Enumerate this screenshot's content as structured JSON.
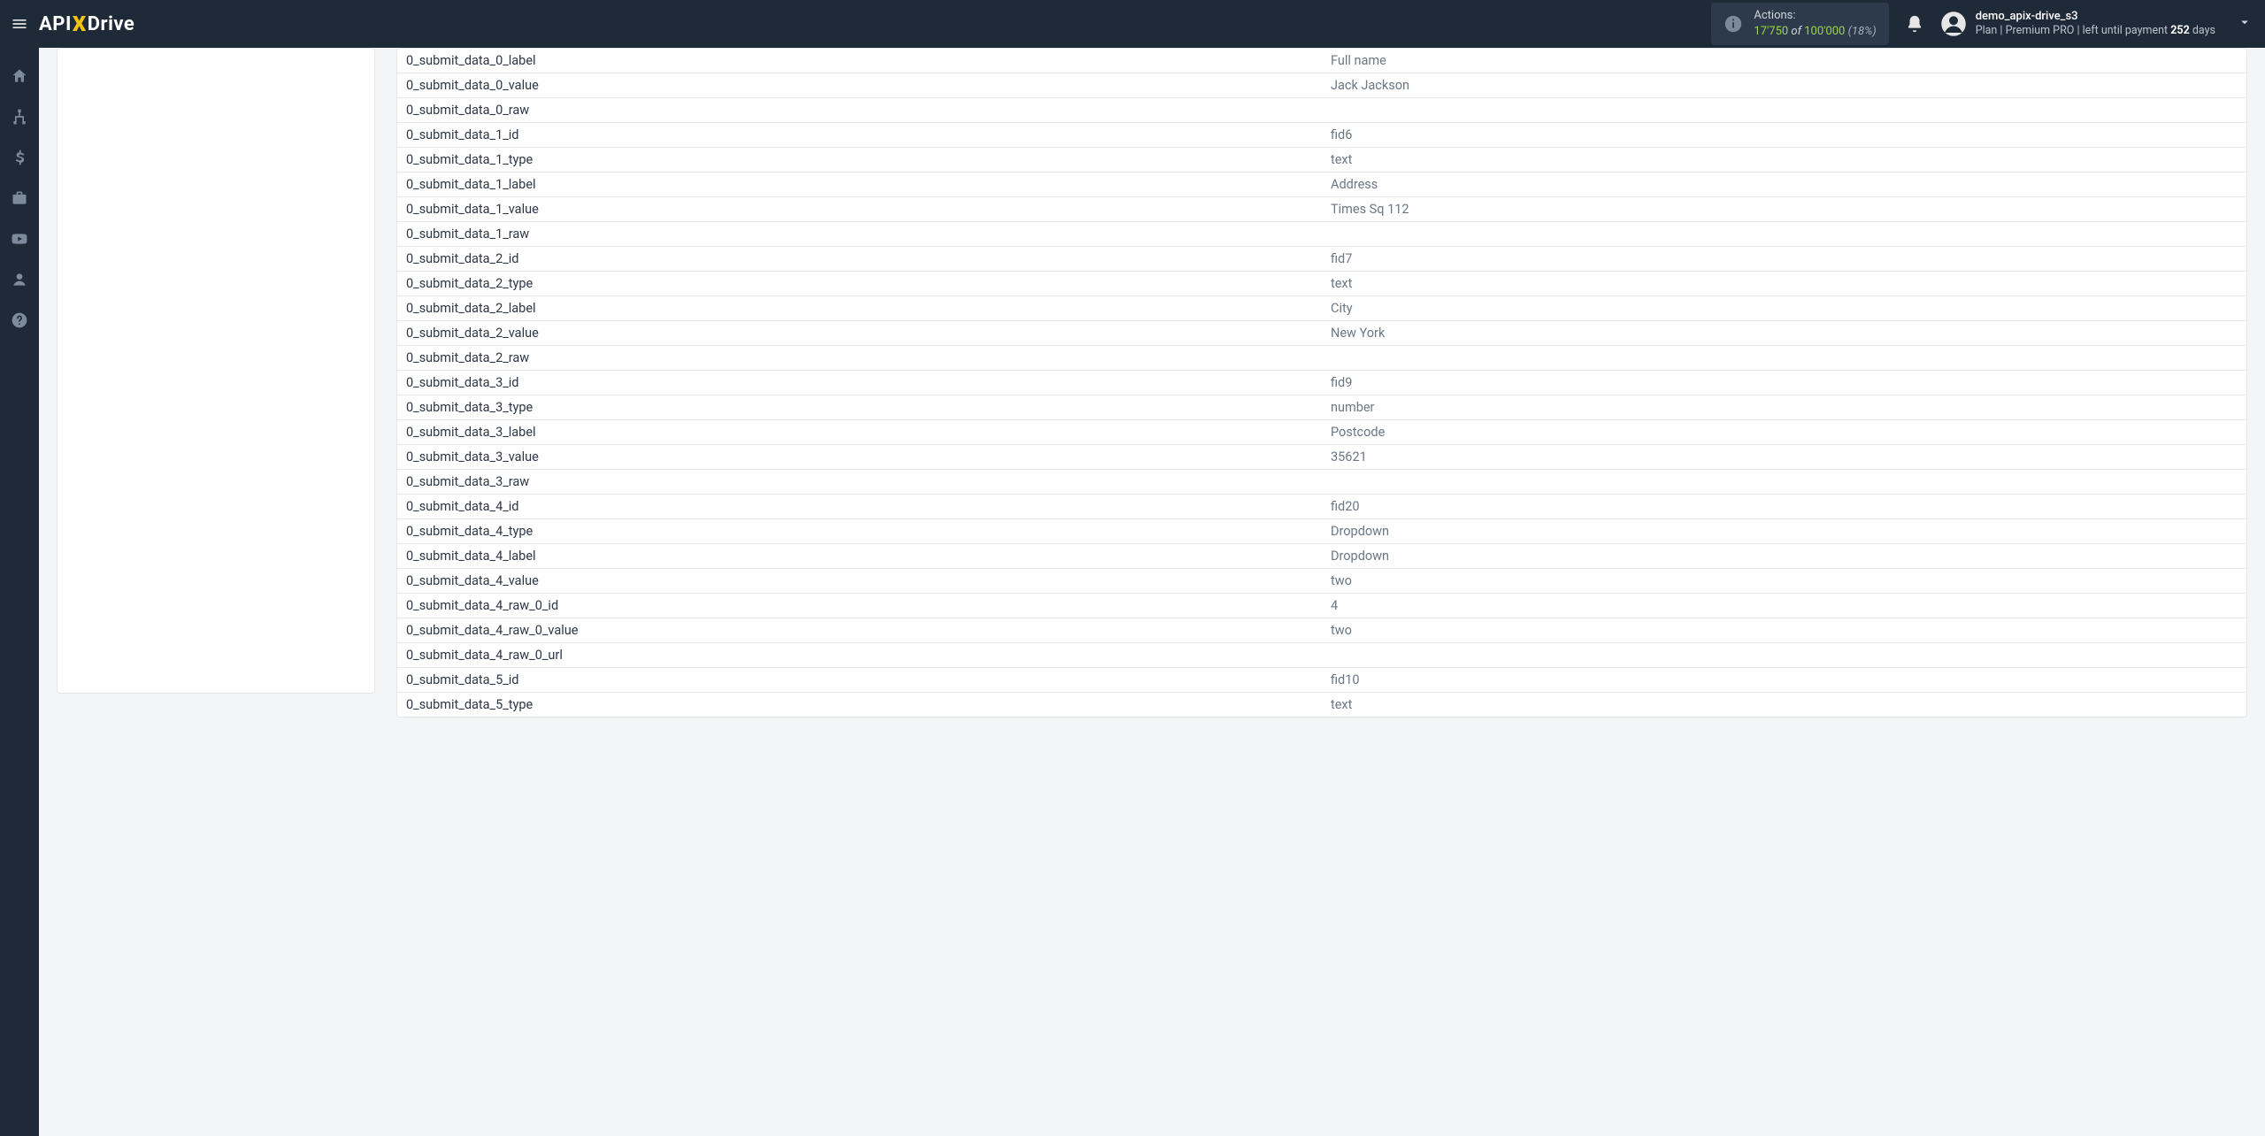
{
  "brand": {
    "api": "API",
    "x": "X",
    "drive": "Drive"
  },
  "header": {
    "actions_label": "Actions:",
    "actions_used": "17'750",
    "actions_of": "of",
    "actions_total": "100'000",
    "actions_pct": "(18%)",
    "username": "demo_apix-drive_s3",
    "plan_prefix": "Plan |",
    "plan_name": "Premium PRO",
    "plan_sep": "| left until payment",
    "days_num": "252",
    "days_label": "days"
  },
  "table_rows": [
    {
      "key": "0_submit_data_0_label",
      "val": "Full name"
    },
    {
      "key": "0_submit_data_0_value",
      "val": "Jack Jackson"
    },
    {
      "key": "0_submit_data_0_raw",
      "val": ""
    },
    {
      "key": "0_submit_data_1_id",
      "val": "fid6"
    },
    {
      "key": "0_submit_data_1_type",
      "val": "text"
    },
    {
      "key": "0_submit_data_1_label",
      "val": "Address"
    },
    {
      "key": "0_submit_data_1_value",
      "val": "Times Sq 112"
    },
    {
      "key": "0_submit_data_1_raw",
      "val": ""
    },
    {
      "key": "0_submit_data_2_id",
      "val": "fid7"
    },
    {
      "key": "0_submit_data_2_type",
      "val": "text"
    },
    {
      "key": "0_submit_data_2_label",
      "val": "City"
    },
    {
      "key": "0_submit_data_2_value",
      "val": "New York"
    },
    {
      "key": "0_submit_data_2_raw",
      "val": ""
    },
    {
      "key": "0_submit_data_3_id",
      "val": "fid9"
    },
    {
      "key": "0_submit_data_3_type",
      "val": "number"
    },
    {
      "key": "0_submit_data_3_label",
      "val": "Postcode"
    },
    {
      "key": "0_submit_data_3_value",
      "val": "35621"
    },
    {
      "key": "0_submit_data_3_raw",
      "val": ""
    },
    {
      "key": "0_submit_data_4_id",
      "val": "fid20"
    },
    {
      "key": "0_submit_data_4_type",
      "val": "Dropdown"
    },
    {
      "key": "0_submit_data_4_label",
      "val": "Dropdown"
    },
    {
      "key": "0_submit_data_4_value",
      "val": "two"
    },
    {
      "key": "0_submit_data_4_raw_0_id",
      "val": "4"
    },
    {
      "key": "0_submit_data_4_raw_0_value",
      "val": "two"
    },
    {
      "key": "0_submit_data_4_raw_0_url",
      "val": ""
    },
    {
      "key": "0_submit_data_5_id",
      "val": "fid10"
    },
    {
      "key": "0_submit_data_5_type",
      "val": "text"
    }
  ]
}
